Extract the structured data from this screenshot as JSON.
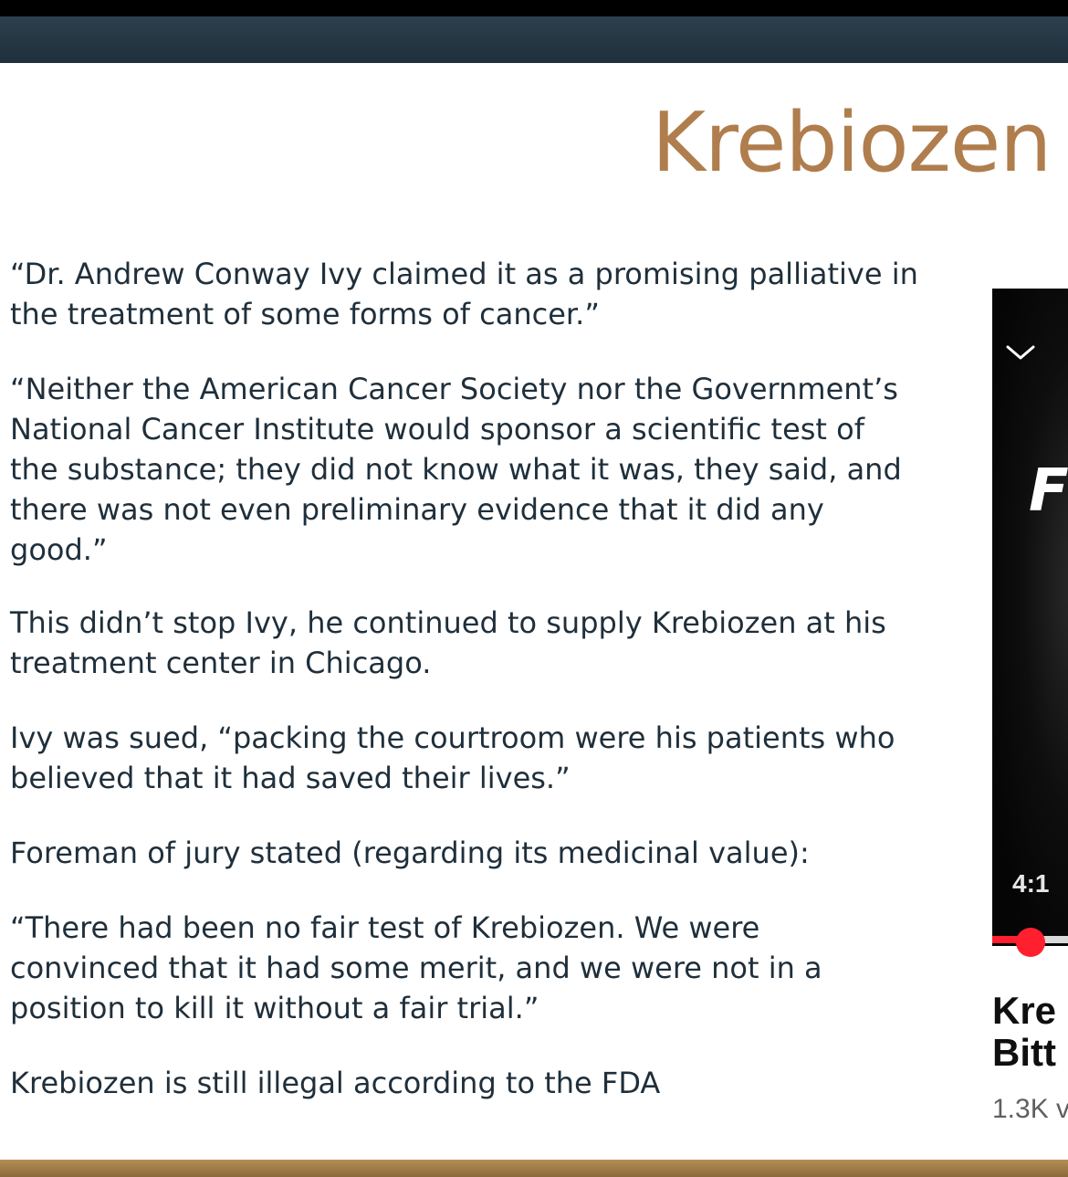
{
  "slide": {
    "title": "Krebiozen",
    "paragraphs": [
      "“Dr. Andrew Conway Ivy claimed it as a promising palliative in the treatment of some forms of cancer.”",
      "“Neither the American Cancer Society nor the Government’s National Cancer Institute would sponsor a scientific test of the substance; they did not know what it was, they said, and there was not even preliminary evidence that it did any good.”",
      "This didn’t stop Ivy, he continued to supply Krebiozen at his treatment center in Chicago.",
      "Ivy was sued, “packing the courtroom were his patients who believed that it had saved their lives.”",
      "Foreman of jury stated (regarding its medicinal value):",
      "“There had been no fair test of Krebiozen. We were convinced that it had some merit, and we were not in a position to kill it without a fair trial.”",
      "Krebiozen is still illegal according to the FDA"
    ],
    "paragraph_lines": [
      [
        "“Dr. Andrew Conway Ivy claimed it as a promising palliative in",
        "the treatment of some forms of cancer.”"
      ],
      [
        "“Neither the American Cancer Society nor the Government’s",
        "National Cancer Institute would sponsor a scientific test of",
        "the substance; they did not know what it was, they said, and",
        "there was not even preliminary evidence that it did any",
        "good.”"
      ],
      [
        "This didn’t stop Ivy, he continued to supply Krebiozen at his",
        "treatment center in Chicago."
      ],
      [
        "Ivy was sued, “packing the courtroom were his patients who",
        "believed that it had saved their lives.”"
      ],
      [
        "Foreman of jury stated (regarding its medicinal value):"
      ],
      [
        "“There had been no fair test of Krebiozen. We were",
        "convinced that it had some merit, and we were not in a",
        "position to kill it without a fair trial.”"
      ],
      [
        "Krebiozen is still illegal according to the FDA"
      ]
    ]
  },
  "video": {
    "chevron_icon": "chevron-down-icon",
    "overlay_letter": "F",
    "timestamp": "4:1",
    "progress_color": "#ff1f2f",
    "title_lines": [
      "Kre",
      "Bitt"
    ],
    "meta": "1.3K v"
  },
  "colors": {
    "title": "#b07d4d",
    "text": "#1f2f3b",
    "top_bar": "#24343f",
    "bottom_bar": "#a17d4a"
  }
}
